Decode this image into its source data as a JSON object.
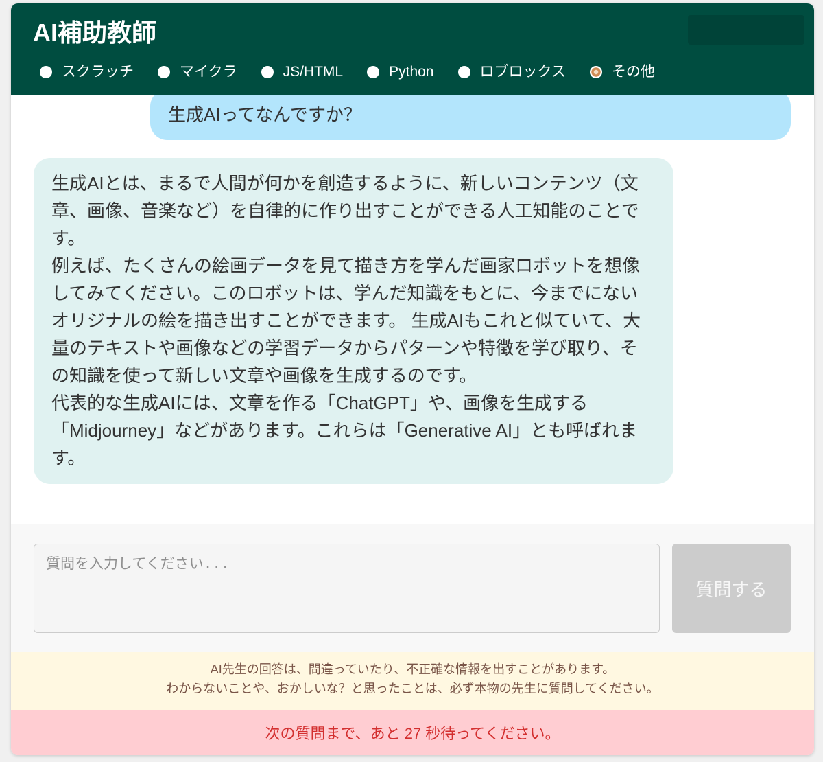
{
  "header": {
    "title": "AI補助教師",
    "categories": [
      {
        "label": "スクラッチ",
        "selected": false
      },
      {
        "label": "マイクラ",
        "selected": false
      },
      {
        "label": "JS/HTML",
        "selected": false
      },
      {
        "label": "Python",
        "selected": false
      },
      {
        "label": "ロブロックス",
        "selected": false
      },
      {
        "label": "その他",
        "selected": true
      }
    ]
  },
  "chat": {
    "question": "生成AIってなんですか？",
    "answer": [
      "生成AIとは、まるで人間が何かを創造するように、新しいコンテンツ（文章、画像、音楽など）を自律的に作り出すことができる人工知能のことです。",
      "例えば、たくさんの絵画データを見て描き方を学んだ画家ロボットを想像してみてください。このロボットは、学んだ知識をもとに、今までにないオリジナルの絵を描き出すことができます。 生成AIもこれと似ていて、大量のテキストや画像などの学習データからパターンや特徴を学び取り、その知識を使って新しい文章や画像を生成するのです。",
      "代表的な生成AIには、文章を作る「ChatGPT」や、画像を生成する「Midjourney」などがあります。これらは「Generative AI」とも呼ばれます。"
    ]
  },
  "composer": {
    "placeholder": "質問を入力してください...",
    "submit_label": "質問する",
    "submit_disabled": true
  },
  "disclaimer": {
    "lines": [
      "AI先生の回答は、間違っていたり、不正確な情報を出すことがあります。",
      "わからないことや、おかしいな？と思ったことは、必ず本物の先生に質問してください。"
    ]
  },
  "cooldown": {
    "message": "次の質問まで、あと 27 秒待ってください。"
  },
  "theme": {
    "header_bg": "#004d40",
    "user_bubble_bg": "#b3e5fc",
    "assistant_bubble_bg": "#e0f2f1",
    "disclaimer_bg": "#fff8e1",
    "disclaimer_text": "#795548",
    "cooldown_bg": "#ffcdd2",
    "cooldown_text": "#d32f2f",
    "radio_accent": "#d08c55",
    "button_disabled_bg": "#cccccc"
  }
}
